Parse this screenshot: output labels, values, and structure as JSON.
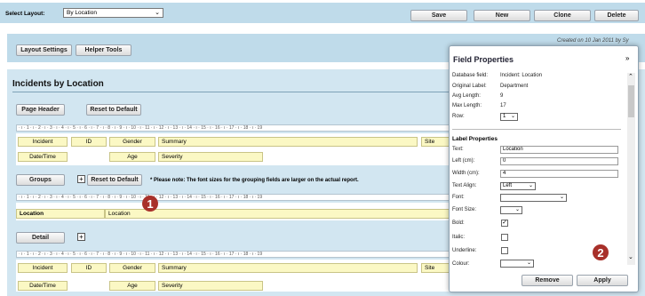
{
  "toolbar": {
    "select_layout_label": "Select Layout:",
    "layout_value": "By Location",
    "save_label": "Save",
    "new_label": "New",
    "clone_label": "Clone",
    "delete_label": "Delete"
  },
  "settings": {
    "layout_settings_label": "Layout Settings",
    "helper_tools_label": "Helper Tools",
    "created_text": "Created on 10 Jan 2011 by Sy"
  },
  "report": {
    "title": "Incidents by Location",
    "page_header_label": "Page Header",
    "reset_label": "Reset to Default",
    "groups_label": "Groups",
    "groups_note": "* Please note: The font sizes for the grouping fields are larger on the actual report.",
    "detail_label": "Detail",
    "ruler_text": "· ı · 1 · ı · 2 · ı · 3 · ı · 4 · ı · 5 · ı · 6 · ı · 7 · ı · 8 · ı · 9 · ı · 10 · ı · 11 · ı · 12 · ı · 13 · ı · 14 · ı · 15 · ı · 16 · ı · 17 · ı · 18 · ı · 19",
    "header_fields_row1": [
      "Incident",
      "ID",
      "Gender",
      "Summary",
      "Site"
    ],
    "header_fields_row2": [
      "Date/Time",
      "Age",
      "Severity"
    ],
    "group_fields": [
      "Location",
      "Location"
    ],
    "detail_fields_row1": [
      "Incident",
      "ID",
      "Gender",
      "Summary",
      "Site"
    ],
    "detail_fields_row2": [
      "Date/Time",
      "Age",
      "Severity"
    ]
  },
  "markers": {
    "one": "1",
    "two": "2"
  },
  "panel": {
    "title": "Field Properties",
    "db_field_label": "Database field:",
    "db_field_value": "Incident: Location",
    "orig_label_label": "Original Label:",
    "orig_label_value": "Department",
    "avg_length_label": "Avg Length:",
    "avg_length_value": "9",
    "max_length_label": "Max Length:",
    "max_length_value": "17",
    "row_label": "Row:",
    "row_value": "1",
    "label_properties_heading": "Label Properties",
    "text_label": "Text:",
    "text_value": "Location",
    "left_label": "Left (cm):",
    "left_value": "0",
    "width_label": "Width (cm):",
    "width_value": "4",
    "text_align_label": "Text Align:",
    "text_align_value": "Left",
    "font_label": "Font:",
    "font_size_label": "Font Size:",
    "bold_label": "Bold:",
    "italic_label": "Italic:",
    "underline_label": "Underline:",
    "colour_label": "Colour:",
    "remove_label": "Remove",
    "apply_label": "Apply"
  }
}
